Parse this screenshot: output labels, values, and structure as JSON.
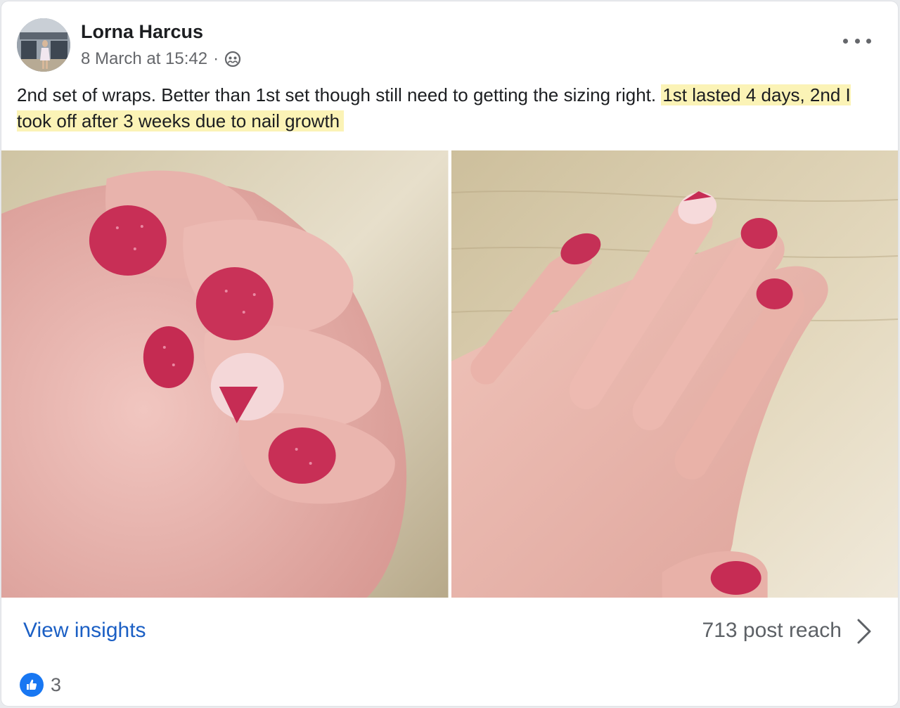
{
  "post": {
    "author": "Lorna Harcus",
    "timestamp": "8 March at 15:42",
    "separator": "·",
    "privacy_icon": "friends-icon",
    "text_plain": "2nd set of wraps. Better than 1st set though still need to getting the sizing right.",
    "text_highlighted": "1st lasted 4 days, 2nd I took off after 3 weeks due to nail growth",
    "photos": [
      {
        "alt": "Hand with pink glitter nail wraps, fingers curled"
      },
      {
        "alt": "Flat hand on wooden table with pink nail wraps"
      }
    ]
  },
  "menu": {
    "icon": "more-options-icon"
  },
  "footer": {
    "insights_label": "View insights",
    "reach_label": "713 post reach",
    "chevron_icon": "chevron-right-icon"
  },
  "reactions": {
    "icon": "like-icon",
    "count": "3"
  },
  "colors": {
    "link_blue": "#1b5fc4",
    "highlight": "#fbf3b6",
    "like_blue": "#1877f2",
    "meta_gray": "#65676b"
  }
}
